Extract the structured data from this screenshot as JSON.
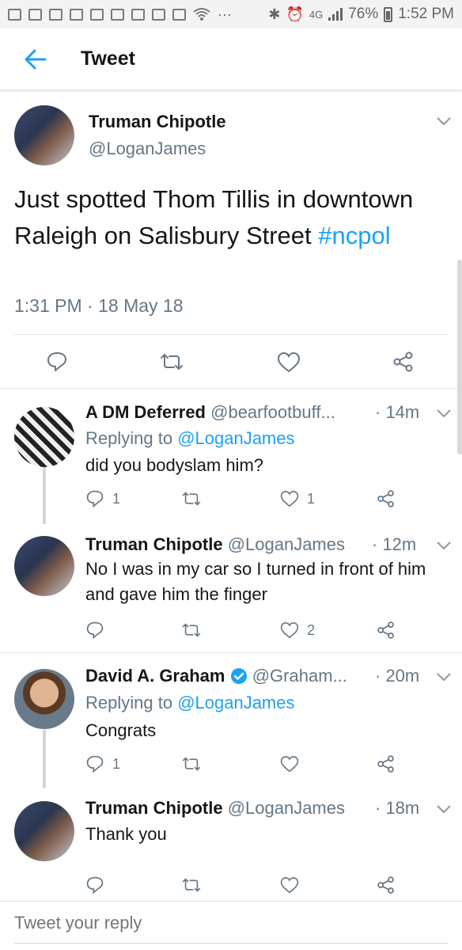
{
  "status_bar": {
    "network": "4G",
    "battery": "76%",
    "time": "1:52 PM"
  },
  "header": {
    "title": "Tweet",
    "back_icon": "arrow-left-icon"
  },
  "main_tweet": {
    "name": "Truman Chipotle",
    "handle": "@LoganJames",
    "text": "Just spotted Thom Tillis in downtown Raleigh on Salisbury Street ",
    "hashtag": "#ncpol",
    "timestamp": "1:31 PM · 18 May 18"
  },
  "replies": [
    {
      "name": "A DM Deferred",
      "handle": "@bearfootbuff...",
      "time": "· 14m",
      "replying_prefix": "Replying to ",
      "replying_to": "@LoganJames",
      "text": "did you bodyslam him?",
      "reply_count": "1",
      "like_count": "1"
    },
    {
      "name": "Truman Chipotle",
      "handle": "@LoganJames",
      "time": "· 12m",
      "text": "No I was in my car so I turned in front of him and gave him the finger",
      "reply_count": "",
      "like_count": "2"
    },
    {
      "name": "David A. Graham",
      "handle": "@Graham...",
      "time": "· 20m",
      "replying_prefix": "Replying to ",
      "replying_to": "@LoganJames",
      "text": "Congrats",
      "reply_count": "1",
      "like_count": ""
    },
    {
      "name": "Truman Chipotle",
      "handle": "@LoganJames",
      "time": "· 18m",
      "text": "Thank you",
      "reply_count": "",
      "like_count": ""
    }
  ],
  "reply_bar": {
    "placeholder": "Tweet your reply"
  },
  "colors": {
    "accent": "#1da1f2",
    "secondary_text": "#657786",
    "divider": "#e1e8ed",
    "thread_line": "#ccd6dd"
  }
}
